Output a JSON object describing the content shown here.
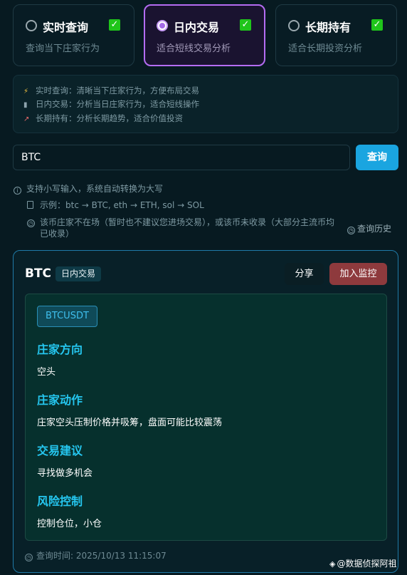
{
  "modes": [
    {
      "label": "实时查询",
      "desc": "查询当下庄家行为",
      "selected": false,
      "checked": true
    },
    {
      "label": "日内交易",
      "desc": "适合短线交易分析",
      "selected": true,
      "checked": true
    },
    {
      "label": "长期持有",
      "desc": "适合长期投资分析",
      "selected": false,
      "checked": true
    }
  ],
  "info": {
    "lines": [
      {
        "icon": "lightning-icon",
        "text": "实时查询：清晰当下庄家行为，方便布局交易"
      },
      {
        "icon": "bar-chart-icon",
        "text": "日内交易：分析当日庄家行为，适合短线操作"
      },
      {
        "icon": "trend-chart-icon",
        "text": "长期持有：分析长期趋势，适合价值投资"
      }
    ]
  },
  "search": {
    "value": "BTC",
    "button": "查询"
  },
  "hints": {
    "h0": "支持小写输入，系统自动转换为大写",
    "h1": "示例：btc → BTC, eth → ETH, sol → SOL",
    "h2": "该币庄家不在场（暂时也不建议您进场交易），或该币未收录（大部分主流币均已收录）",
    "history": "查询历史"
  },
  "result": {
    "symbol": "BTC",
    "mode_tag": "日内交易",
    "share": "分享",
    "monitor": "加入监控",
    "pair": "BTCUSDT",
    "sections": [
      {
        "title": "庄家方向",
        "body": "空头"
      },
      {
        "title": "庄家动作",
        "body": "庄家空头压制价格并吸筹，盘面可能比较震荡"
      },
      {
        "title": "交易建议",
        "body": "寻找做多机会"
      },
      {
        "title": "风险控制",
        "body": "控制仓位，小仓"
      }
    ],
    "time": "查询时间: 2025/10/13 11:15:07"
  },
  "watermark": "@数据侦探阿祖",
  "colors": {
    "accent": "#1aa5e0",
    "selected_border": "#b46cf2",
    "section_title": "#25c6ef",
    "monitor_button": "#8e3a3d",
    "check": "#1fc51a"
  }
}
